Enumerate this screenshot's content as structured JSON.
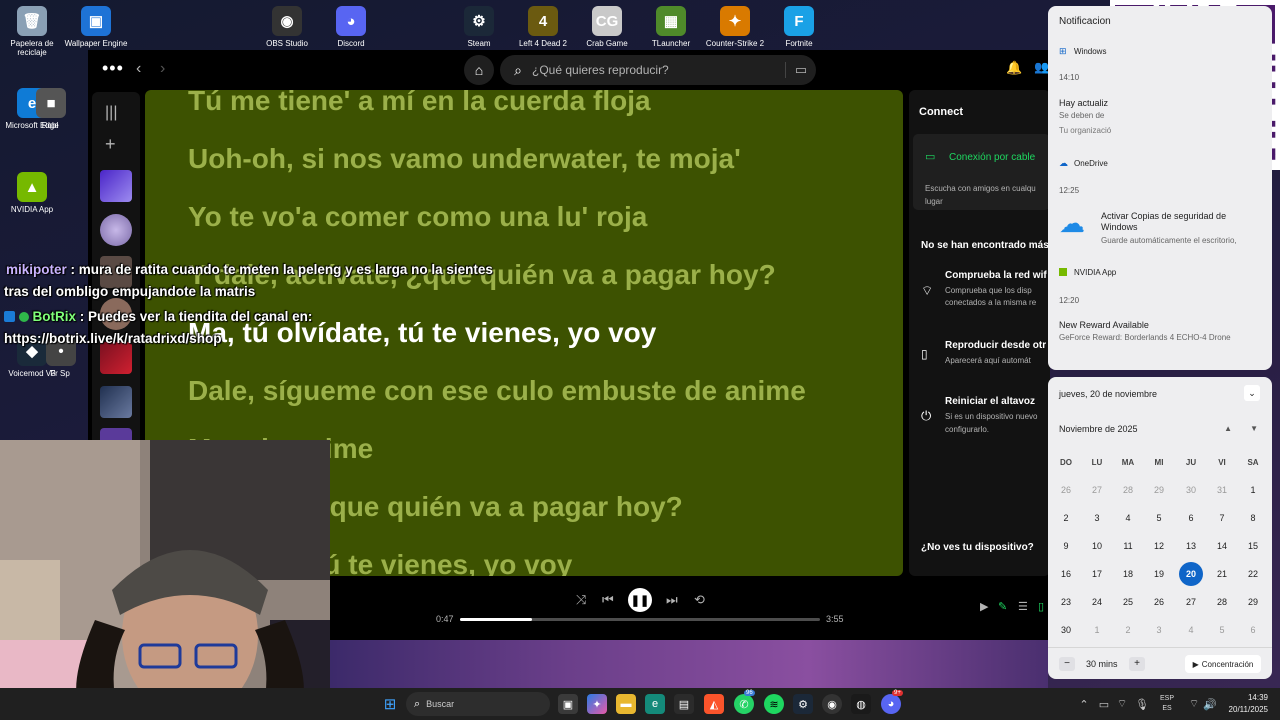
{
  "desktop_top_icons": [
    {
      "label": "OBS Studio",
      "color": "#333333",
      "glyph": "◉"
    },
    {
      "label": "Discord",
      "color": "#5865f2",
      "glyph": "◕"
    },
    {
      "label": "Steam",
      "color": "#1b2838",
      "glyph": "⚙"
    },
    {
      "label": "Left 4 Dead 2",
      "color": "#6b5a10",
      "glyph": "4"
    },
    {
      "label": "Crab Game",
      "color": "#c9c9c9",
      "glyph": "CG"
    },
    {
      "label": "TLauncher",
      "color": "#4f8a2a",
      "glyph": "▦"
    },
    {
      "label": "Counter-Strike 2",
      "color": "#d97a00",
      "glyph": "✦"
    },
    {
      "label": "Fortnite",
      "color": "#1aa1e6",
      "glyph": "F"
    }
  ],
  "desktop_left_icons": [
    {
      "label": "Papelera de reciclaje",
      "color": "#8aa0b5",
      "glyph": "🗑"
    },
    {
      "label": "Wallpaper Engine",
      "color": "#1e73d6",
      "glyph": "▣"
    },
    {
      "label": "Microsoft Edge",
      "color": "#0f7bd6",
      "glyph": "e"
    },
    {
      "label": "Robl",
      "color": "#555555",
      "glyph": "■"
    },
    {
      "label": "NVIDIA App",
      "color": "#76b900",
      "glyph": "▲"
    },
    {
      "label": "Voicemod V3",
      "color": "#1a2a3a",
      "glyph": "◆"
    },
    {
      "label": "Fr Sp",
      "color": "#444444",
      "glyph": "•"
    }
  ],
  "spotify": {
    "search_placeholder": "¿Qué quieres reproducir?",
    "lyrics": [
      "Tú me tiene' a mí en la cuerda floja",
      "Uoh-oh, si nos vamo underwater, te moja'",
      "Yo te vo'a comer como una lu' roja",
      "Y dale, actívate, ¿que quién va a pagar hoy?",
      "Ma, tú olvídate, tú te vienes, yo voy",
      "Dale, sígueme con ese culo embuste de anime",
      "Muy de anime",
      "Actívate, ¿que quién va a pagar hoy?",
      "Olvídate, tú te vienes, yo voy"
    ],
    "connect": {
      "title": "Connect",
      "cable": "Conexión por cable",
      "cable_desc_1": "Escucha con amigos en cualqu",
      "cable_desc_2": "lugar",
      "none_found": "No se han encontrado más",
      "tip1_title": "Comprueba la red wif",
      "tip1_desc_1": "Comprueba que los disp",
      "tip1_desc_2": "conectados a la misma re",
      "tip2_title": "Reproducir desde otr",
      "tip2_desc": "Aparecerá aquí automát",
      "tip3_title": "Reiniciar el altavoz",
      "tip3_desc_1": "Si es un dispositivo nuevo",
      "tip3_desc_2": "configurarlo.",
      "help": "¿No ves tu dispositivo?"
    },
    "player": {
      "elapsed": "0:47",
      "total": "3:55",
      "progress": 0.2
    }
  },
  "chat": [
    {
      "user": "mikipoter",
      "sep": " : ",
      "text": "mura de ratita cuando te meten la peleng y es larga no la sientes"
    },
    {
      "user": "",
      "sep": "",
      "text": "tras del ombligo empujandote la matris"
    },
    {
      "user": "BotRix",
      "sep": " : ",
      "text": "Puedes ver la tiendita del canal en:"
    },
    {
      "user": "",
      "sep": "",
      "text": "https://botrix.live/k/ratadrixd/shop"
    }
  ],
  "notifications": {
    "header": "Notificacion",
    "group1_app": "Windows",
    "group1_time": "14:10",
    "group1_title": "Hay actualiz",
    "group1_body": "Se deben de",
    "group1_extra": "Tu organizació",
    "group2_app": "OneDrive",
    "group2_time": "12:25",
    "group2_title_1": "Activar Copias de seguridad de",
    "group2_title_2": "Windows",
    "group2_body": "Guarde automáticamente el escritorio,",
    "group3_app": "NVIDIA App",
    "group3_time": "12:20",
    "group3_title": "New Reward Available",
    "group3_body": "GeForce Reward: Borderlands 4 ECHO-4 Drone",
    "qr_label": "yape"
  },
  "calendar": {
    "date_header": "jueves, 20 de noviembre",
    "month": "Noviembre de 2025",
    "weekdays": [
      "DO",
      "LU",
      "MA",
      "MI",
      "JU",
      "VI",
      "SA"
    ],
    "days": [
      [
        "26",
        "27",
        "28",
        "29",
        "30",
        "31",
        "1"
      ],
      [
        "2",
        "3",
        "4",
        "5",
        "6",
        "7",
        "8"
      ],
      [
        "9",
        "10",
        "11",
        "12",
        "13",
        "14",
        "15"
      ],
      [
        "16",
        "17",
        "18",
        "19",
        "20",
        "21",
        "22"
      ],
      [
        "23",
        "24",
        "25",
        "26",
        "27",
        "28",
        "29"
      ],
      [
        "30",
        "1",
        "2",
        "3",
        "4",
        "5",
        "6"
      ]
    ],
    "today": "20",
    "focus_minutes": "30 mins",
    "focus_button": "Concentración"
  },
  "taskbar": {
    "search_placeholder": "Buscar",
    "lang_1": "ESP",
    "lang_2": "ES",
    "time": "14:39",
    "date": "20/11/2025",
    "whatsapp_badge": "96",
    "discord_badge": "9+"
  }
}
